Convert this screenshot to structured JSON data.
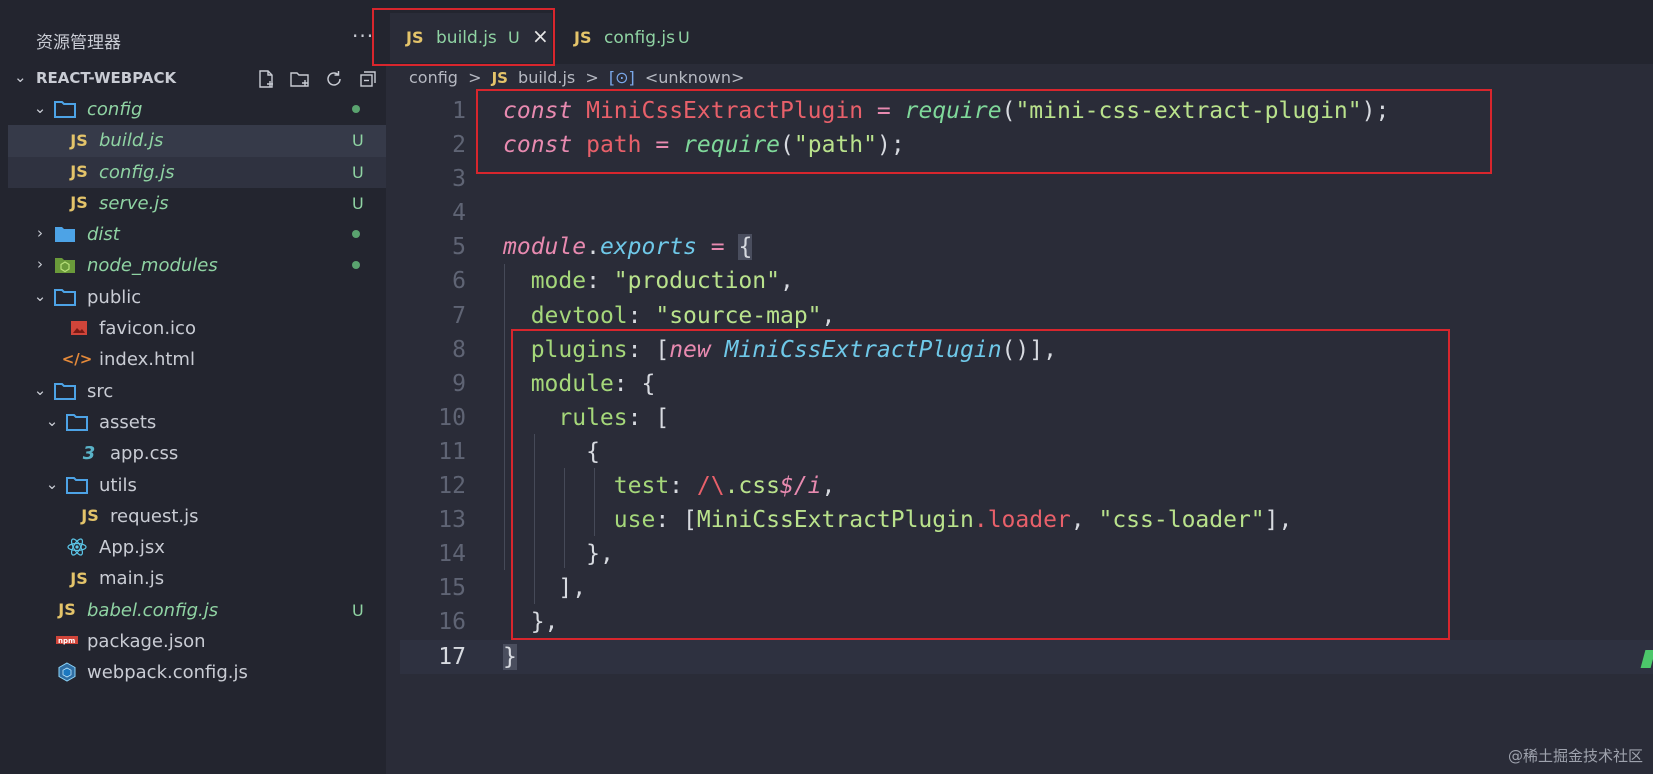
{
  "sidebar": {
    "title": "资源管理器",
    "more": "···",
    "project": "REACT-WEBPACK",
    "items": [
      {
        "label": "config",
        "type": "folder",
        "open": true,
        "depth": 1,
        "status": "dot"
      },
      {
        "label": "build.js",
        "type": "js",
        "depth": 2,
        "status": "U"
      },
      {
        "label": "config.js",
        "type": "js",
        "depth": 2,
        "status": "U"
      },
      {
        "label": "serve.js",
        "type": "js",
        "depth": 2,
        "status": "U"
      },
      {
        "label": "dist",
        "type": "folder",
        "open": false,
        "depth": 1,
        "status": "dot"
      },
      {
        "label": "node_modules",
        "type": "node",
        "open": false,
        "depth": 1,
        "status": "dot"
      },
      {
        "label": "public",
        "type": "folder",
        "open": true,
        "depth": 1,
        "status": ""
      },
      {
        "label": "favicon.ico",
        "type": "image",
        "depth": 2,
        "status": ""
      },
      {
        "label": "index.html",
        "type": "html",
        "depth": 2,
        "status": ""
      },
      {
        "label": "src",
        "type": "folder",
        "open": true,
        "depth": 1,
        "status": ""
      },
      {
        "label": "assets",
        "type": "folder",
        "open": true,
        "depth": 2,
        "status": ""
      },
      {
        "label": "app.css",
        "type": "css",
        "depth": 3,
        "status": ""
      },
      {
        "label": "utils",
        "type": "folder",
        "open": true,
        "depth": 2,
        "status": ""
      },
      {
        "label": "request.js",
        "type": "js",
        "depth": 3,
        "status": ""
      },
      {
        "label": "App.jsx",
        "type": "react",
        "depth": 2,
        "status": ""
      },
      {
        "label": "main.js",
        "type": "js",
        "depth": 2,
        "status": ""
      },
      {
        "label": "babel.config.js",
        "type": "js",
        "depth": 1,
        "status": "U"
      },
      {
        "label": "package.json",
        "type": "npm",
        "depth": 1,
        "status": ""
      },
      {
        "label": "webpack.config.js",
        "type": "webpack",
        "depth": 1,
        "status": ""
      }
    ]
  },
  "tabs": [
    {
      "icon": "JS",
      "label": "build.js",
      "status": "U",
      "close": "×",
      "active": true
    },
    {
      "icon": "JS",
      "label": "config.js",
      "status": "U",
      "active": false
    }
  ],
  "breadcrumb": {
    "folder": "config",
    "sep": ">",
    "file_icon": "JS",
    "file": "build.js",
    "symbol": "<unknown>"
  },
  "code_lines": [
    "1",
    "2",
    "3",
    "4",
    "5",
    "6",
    "7",
    "8",
    "9",
    "10",
    "11",
    "12",
    "13",
    "14",
    "15",
    "16",
    "17"
  ],
  "code": {
    "const": "const",
    "mini_plugin": "MiniCssExtractPlugin",
    "eq": "=",
    "require": "require",
    "mini_str": "\"mini-css-extract-plugin\"",
    "path_var": "path",
    "path_str": "\"path\"",
    "module": "module",
    "exports": "exports",
    "mode_key": "mode",
    "mode_val": "\"production\"",
    "devtool_key": "devtool",
    "devtool_val": "\"source-map\"",
    "plugins_key": "plugins",
    "new": "new",
    "module_key": "module",
    "rules_key": "rules",
    "test_key": "test",
    "test_val_a": "/\\",
    "test_val_b": ".css",
    "test_val_c": "$/i",
    "use_key": "use",
    "loader": "loader",
    "css_loader": "\"css-loader\""
  },
  "watermark": "@稀土掘金技术社区",
  "colors": {
    "highlight_box": "#d8262d",
    "modified": "#8fd3a3",
    "js_icon": "#e4c46a"
  }
}
